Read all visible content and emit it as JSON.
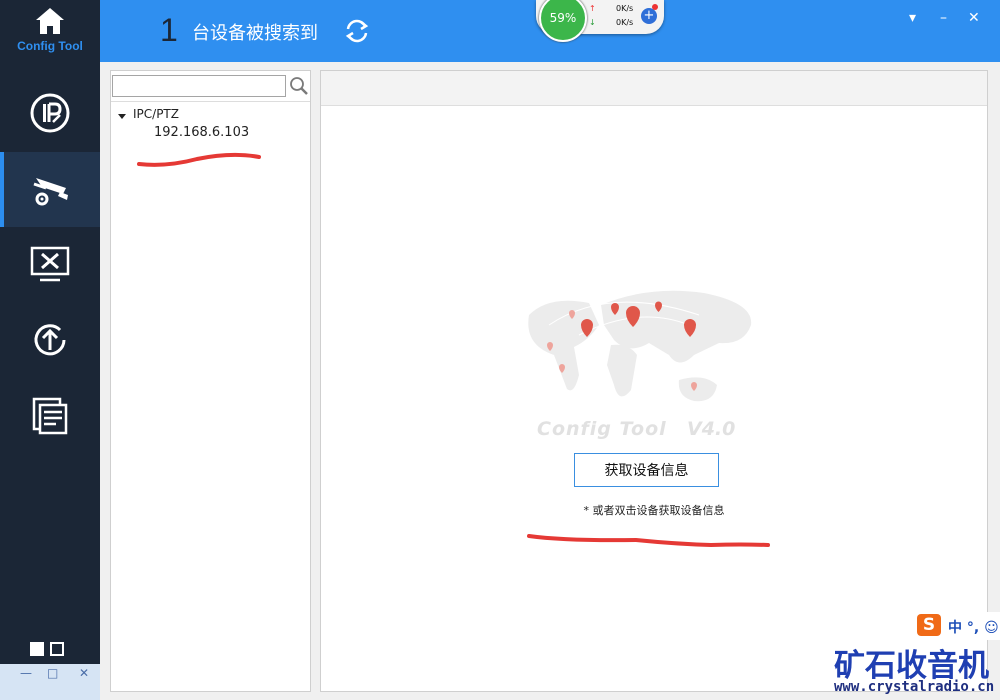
{
  "app": {
    "logo_text": "Config Tool"
  },
  "header": {
    "device_count": "1",
    "title": "台设备被搜索到",
    "controls": [
      "▾",
      "–",
      "✕"
    ]
  },
  "net_widget": {
    "cpu_percent": "59%",
    "upload": "0K/s",
    "download": "0K/s"
  },
  "sidebar": {
    "items": [
      {
        "icon": "ip-icon",
        "active": false
      },
      {
        "icon": "camera-settings-icon",
        "active": true
      },
      {
        "icon": "tools-monitor-icon",
        "active": false
      },
      {
        "icon": "upgrade-icon",
        "active": false
      },
      {
        "icon": "document-list-icon",
        "active": false
      }
    ]
  },
  "tree": {
    "search_value": "",
    "group_label": "IPC/PTZ",
    "device_ip": "192.168.6.103"
  },
  "content": {
    "brand": "Config Tool",
    "version": "V4.0",
    "get_button_label": "获取设备信息",
    "hint": "* 或者双击设备获取设备信息"
  },
  "watermark": {
    "ime_logo": "S",
    "ime_text": "中 °, ☺",
    "title": "矿石收音机",
    "url": "www.crystalradio.cn"
  },
  "bottom_left": {
    "buttons": [
      "—",
      "□",
      "✕"
    ]
  },
  "colors": {
    "sidebar_bg": "#1b2636",
    "header_bg": "#2f8ff0",
    "accent": "#2c8ef0",
    "cpu_green": "#3cb64a",
    "annotation_red": "#e53935"
  }
}
